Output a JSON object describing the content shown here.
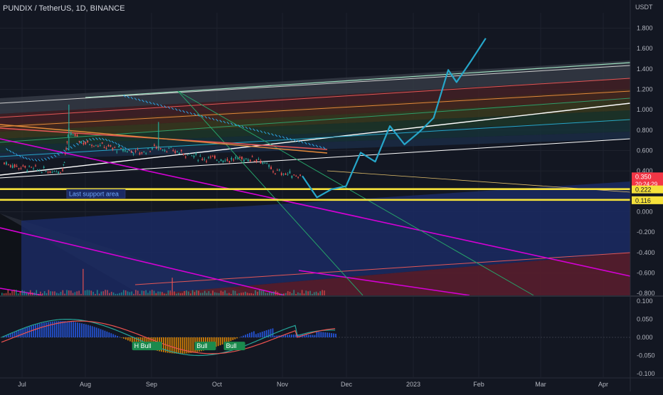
{
  "header": {
    "symbol_title": "PUNDIX / TetherUS, 1D, BINANCE"
  },
  "colors": {
    "background": "#131722",
    "grid": "#1e222d",
    "axis_text": "#b2b5be",
    "candle_up": "#26a69a",
    "candle_down": "#ef5350",
    "forecast": "#26a6c9",
    "support": "#f5e13b",
    "magenta": "#d500d5",
    "price_badge": "#f23645"
  },
  "chart_data": [
    {
      "type": "line",
      "name": "price-pane",
      "y_axis_unit_label": "USDT",
      "ylim": [
        -0.82,
        1.95
      ],
      "x_ticks": [
        "Jul",
        "Aug",
        "Sep",
        "Oct",
        "Nov",
        "Dec",
        "2023",
        "Feb",
        "Mar",
        "Apr"
      ],
      "y_ticks": [
        "1.800",
        "1.600",
        "1.400",
        "1.200",
        "1.000",
        "0.800",
        "0.600",
        "0.400",
        "0.000",
        "-0.200",
        "-0.400",
        "-0.600",
        "-0.800"
      ],
      "y_tick_values": [
        1.8,
        1.6,
        1.4,
        1.2,
        1.0,
        0.8,
        0.6,
        0.4,
        0.0,
        -0.2,
        -0.4,
        -0.6,
        -0.8
      ],
      "price_badges": [
        {
          "text": "0.350",
          "sub": "20:24:29",
          "value": 0.35,
          "bg": "#f23645",
          "fg": "#ffffff"
        },
        {
          "text": "0.222",
          "value": 0.222,
          "bg": "#f5e13b",
          "fg": "#131722"
        },
        {
          "text": "0.116",
          "value": 0.116,
          "bg": "#f5e13b",
          "fg": "#131722"
        }
      ],
      "support_lines": [
        0.222,
        0.116
      ],
      "annotation": {
        "text": "Last support area",
        "x": "Jul 31",
        "value": 0.176
      },
      "price_series": {
        "x": [
          "Jul 1",
          "Jul 8",
          "Jul 15",
          "Jul 22",
          "Jul 29",
          "Aug 1",
          "Aug 8",
          "Aug 15",
          "Aug 22",
          "Aug 29",
          "Sep 5",
          "Sep 12",
          "Sep 19",
          "Sep 26",
          "Oct 3",
          "Oct 10",
          "Oct 17",
          "Oct 24",
          "Oct 31",
          "Nov 7",
          "Nov 14",
          "Nov 21"
        ],
        "values": [
          0.48,
          0.44,
          0.42,
          0.4,
          0.41,
          0.78,
          0.68,
          0.66,
          0.62,
          0.6,
          0.58,
          0.64,
          0.6,
          0.57,
          0.53,
          0.52,
          0.51,
          0.52,
          0.52,
          0.4,
          0.37,
          0.35
        ]
      },
      "forecast_series": {
        "x": [
          "Nov 21",
          "Nov 28",
          "Dec 5",
          "Dec 12",
          "Dec 19",
          "Dec 26",
          "Jan 2",
          "Jan 9",
          "Jan 16",
          "Jan 23",
          "Jan 30",
          "Feb 3",
          "Feb 10",
          "Feb 17"
        ],
        "values": [
          0.35,
          0.14,
          0.22,
          0.25,
          0.58,
          0.49,
          0.84,
          0.66,
          0.78,
          0.92,
          1.39,
          1.27,
          1.48,
          1.7
        ]
      }
    },
    {
      "type": "bar",
      "name": "macd-pane",
      "ylim": [
        -0.11,
        0.11
      ],
      "y_ticks": [
        "0.100",
        "0.050",
        "0.000",
        "-0.050",
        "-0.100"
      ],
      "y_tick_values": [
        0.1,
        0.05,
        0.0,
        -0.05,
        -0.1
      ],
      "labels": [
        {
          "text": "H Bull",
          "x": "Sep 1"
        },
        {
          "text": "Bull",
          "x": "Oct 1"
        },
        {
          "text": "Bull",
          "x": "Oct 15"
        }
      ]
    }
  ]
}
